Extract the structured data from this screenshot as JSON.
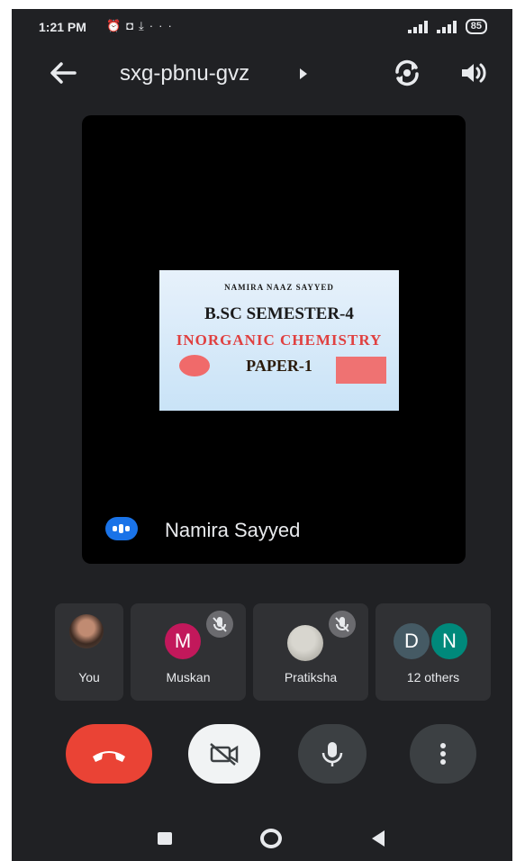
{
  "status_bar": {
    "time": "1:21 PM",
    "notification_icons": [
      "alarm-icon",
      "camera-icon",
      "download-icon",
      "more-dots-icon"
    ],
    "signal_icons": [
      "signal-icon",
      "signal-icon"
    ],
    "battery": "85"
  },
  "header": {
    "meeting_code": "sxg-pbnu-gvz",
    "icons": [
      "back-arrow-icon",
      "caret-right-icon",
      "switch-camera-icon",
      "speaker-icon"
    ]
  },
  "main_tile": {
    "slide": {
      "line1": "NAMIRA NAAZ SAYYED",
      "line2": "B.SC SEMESTER-4",
      "line3": "INORGANIC CHEMISTRY",
      "line4": "PAPER-1"
    },
    "speaker_name": "Namira Sayyed"
  },
  "participants": [
    {
      "label": "You"
    },
    {
      "label": "Muskan",
      "initial": "M",
      "color": "#c2185b",
      "muted": true
    },
    {
      "label": "Pratiksha",
      "muted": true
    },
    {
      "label": "12 others",
      "initials": [
        "D",
        "N"
      ],
      "colors": [
        "#455a64",
        "#00897b"
      ]
    }
  ],
  "controls": [
    "end-call-icon",
    "camera-off-icon",
    "microphone-icon",
    "more-vert-icon"
  ],
  "colors": {
    "background": "#202124",
    "tile": "#303134",
    "end_call": "#ea4335",
    "accent": "#1a73e8"
  }
}
